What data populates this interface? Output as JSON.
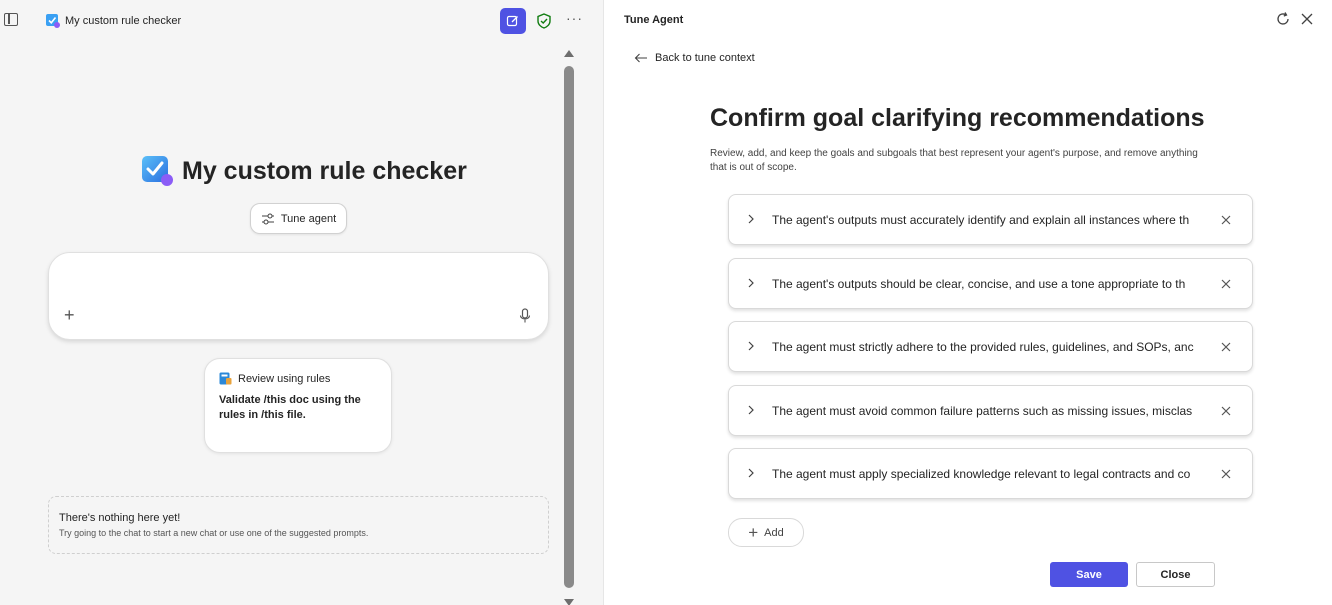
{
  "left_panel": {
    "header": {
      "app_title": "My custom rule checker",
      "icons": [
        "sidebar-icon",
        "checkbox-app-icon",
        "new-chat-icon",
        "shield-check-icon",
        "more-icon"
      ],
      "more_label": "···"
    },
    "hero": {
      "title": "My custom rule checker"
    },
    "tune_button": {
      "label": "Tune agent"
    },
    "composer": {
      "plus": "+",
      "value": ""
    },
    "prompt_card": {
      "title": "Review using rules",
      "body": "Validate /this doc using the rules in /this file."
    },
    "empty_state": {
      "title": "There's nothing here yet!",
      "subtitle": "Try going to the chat to start a new chat or use one of the suggested prompts."
    }
  },
  "right_panel": {
    "title": "Tune Agent",
    "back_label": "Back to tune context",
    "heading": "Confirm goal clarifying recommendations",
    "description": "Review, add, and keep the goals and subgoals that best represent your agent's purpose, and remove anything that is out of scope.",
    "goals": [
      "The agent's outputs must accurately identify and explain all instances where th",
      "The agent's outputs should be clear, concise, and use a tone appropriate to th",
      "The agent must strictly adhere to the provided rules, guidelines, and SOPs, anc",
      "The agent must avoid common failure patterns such as missing issues, misclas",
      "The agent must apply specialized knowledge relevant to legal contracts and co"
    ],
    "add_label": "Add",
    "save_label": "Save",
    "close_label": "Close"
  },
  "colors": {
    "accent": "#4f52e3",
    "left_bg": "#f5f5f5",
    "shield_green": "#107c10"
  }
}
